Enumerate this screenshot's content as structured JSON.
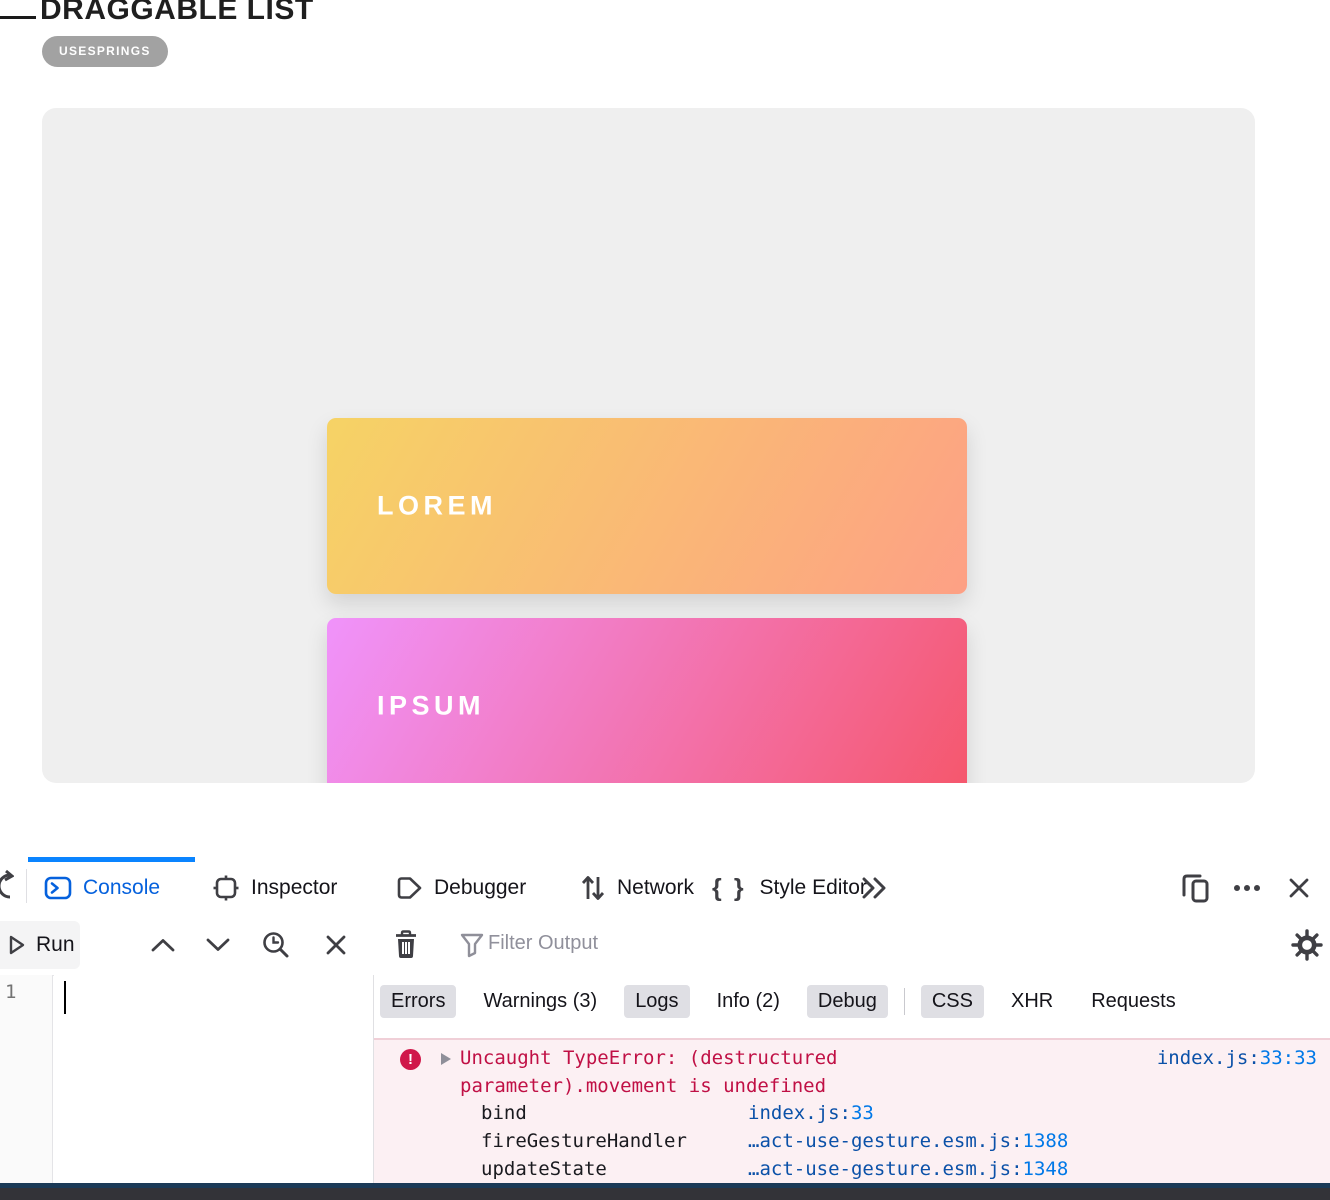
{
  "colors": {
    "accent_blue": "#0a84ff",
    "tab_active_text": "#0561dd",
    "error_text": "#c01045",
    "error_icon": "#d0184a",
    "error_bg": "#fcf0f3",
    "link_file": "#0b51a8",
    "link_line": "#0078e7",
    "panel_bg": "#efefef",
    "badge_bg": "#a2a2a2"
  },
  "page": {
    "heading": "DRAGGABLE LIST",
    "badge": "USESPRINGS",
    "cards": [
      {
        "label": "LOREM",
        "gradient": [
          "#f6d365",
          "#fda085"
        ]
      },
      {
        "label": "IPSUM",
        "gradient": [
          "#f093fb",
          "#f5576c"
        ]
      }
    ]
  },
  "devtools": {
    "tabs": [
      {
        "label": "Console",
        "active": true
      },
      {
        "label": "Inspector",
        "active": false
      },
      {
        "label": "Debugger",
        "active": false
      },
      {
        "label": "Network",
        "active": false
      },
      {
        "label": "Style Editor",
        "active": false
      }
    ],
    "toolbar": {
      "run_label": "Run",
      "filter_placeholder": "Filter Output"
    },
    "filter_buttons": [
      {
        "label": "Errors",
        "active": true
      },
      {
        "label": "Warnings (3)",
        "active": false
      },
      {
        "label": "Logs",
        "active": true
      },
      {
        "label": "Info (2)",
        "active": false
      },
      {
        "label": "Debug",
        "active": true
      },
      {
        "label": "CSS",
        "active": true
      },
      {
        "label": "XHR",
        "active": false
      },
      {
        "label": "Requests",
        "active": false
      }
    ],
    "editor": {
      "line_number": "1"
    },
    "console_output": {
      "error": {
        "message": "Uncaught TypeError: (destructured parameter).movement is undefined",
        "location_file": "index.js:",
        "location_pos": "33:33",
        "stack": [
          {
            "fn": "bind",
            "file": "index.js:",
            "line": "33"
          },
          {
            "fn": "fireGestureHandler",
            "file": "…act-use-gesture.esm.js:",
            "line": "1388"
          },
          {
            "fn": "updateState",
            "file": "…act-use-gesture.esm.js:",
            "line": "1348"
          }
        ]
      }
    }
  }
}
